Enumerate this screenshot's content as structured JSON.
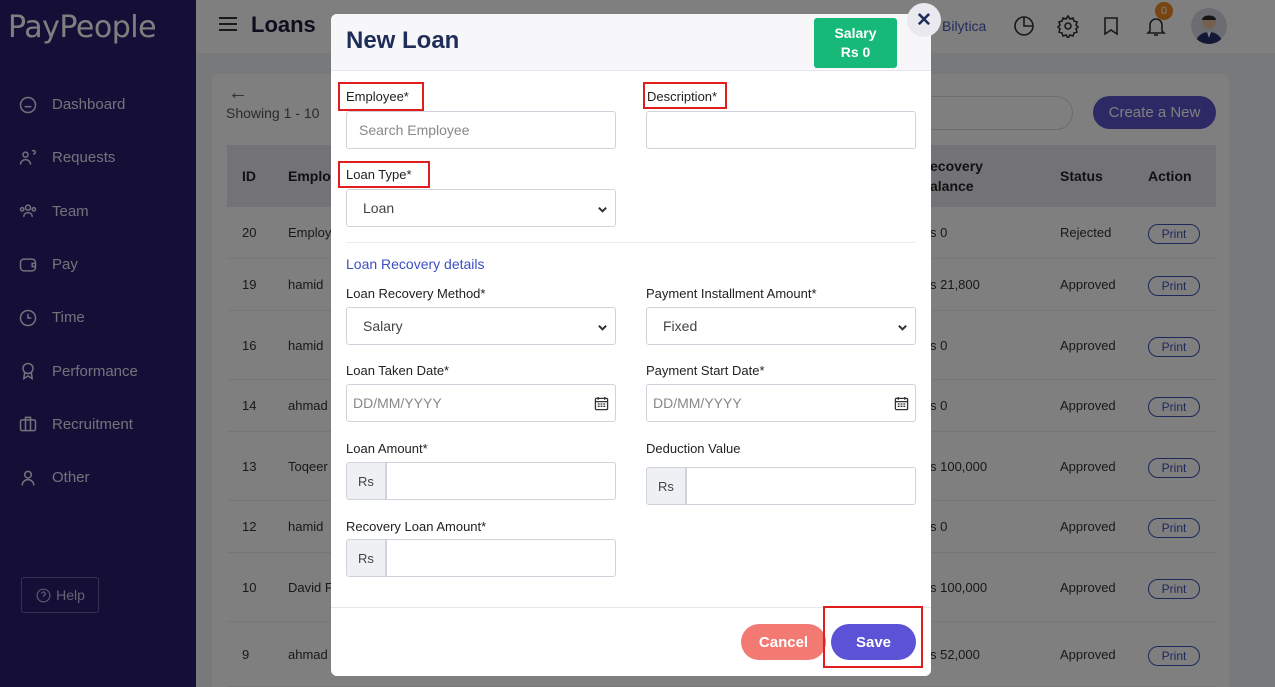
{
  "app": {
    "logo_text": "PayPe",
    "logo_text_end": "ple",
    "logo_o": "o"
  },
  "sidebar": {
    "items": [
      {
        "label": "Dashboard",
        "icon": "home-icon"
      },
      {
        "label": "Requests",
        "icon": "requests-icon"
      },
      {
        "label": "Team",
        "icon": "team-icon"
      },
      {
        "label": "Pay",
        "icon": "wallet-icon"
      },
      {
        "label": "Time",
        "icon": "clock-icon"
      },
      {
        "label": "Performance",
        "icon": "award-icon"
      },
      {
        "label": "Recruitment",
        "icon": "briefcase-icon"
      },
      {
        "label": "Other",
        "icon": "user-icon"
      }
    ],
    "help_label": "Help"
  },
  "header": {
    "title": "Loans",
    "company": "Bilytica",
    "notification_count": "0"
  },
  "list": {
    "back": "←",
    "showing": "Showing 1 - 10",
    "create_label": "Create a New",
    "columns": {
      "id": "ID",
      "employee": "Emplo",
      "recovery_line1": "ecovery",
      "recovery_line2": "alance",
      "status": "Status",
      "action": "Action"
    },
    "rows": [
      {
        "id": "20",
        "employee": "Employ",
        "balance": "s 0",
        "status": "Rejected",
        "action": "Print"
      },
      {
        "id": "19",
        "employee": "hamid",
        "balance": "s 21,800",
        "status": "Approved",
        "action": "Print"
      },
      {
        "id": "16",
        "employee": "hamid",
        "balance": "s 0",
        "status": "Approved",
        "action": "Print"
      },
      {
        "id": "14",
        "employee": "ahmad",
        "balance": "s 0",
        "status": "Approved",
        "action": "Print"
      },
      {
        "id": "13",
        "employee": "Toqeer",
        "balance": "s 100,000",
        "status": "Approved",
        "action": "Print"
      },
      {
        "id": "12",
        "employee": "hamid",
        "balance": "s 0",
        "status": "Approved",
        "action": "Print"
      },
      {
        "id": "10",
        "employee": "David F",
        "balance": "s 100,000",
        "status": "Approved",
        "action": "Print"
      },
      {
        "id": "9",
        "employee": "ahmad",
        "balance": "s 52,000",
        "status": "Approved",
        "action": "Print"
      }
    ]
  },
  "modal": {
    "title": "New Loan",
    "salary_label": "Salary",
    "salary_value": "Rs 0",
    "close": "✕",
    "employee_label": "Employee*",
    "employee_placeholder": "Search Employee",
    "description_label": "Description*",
    "loan_type_label": "Loan Type*",
    "loan_type_value": "Loan",
    "section_title": "Loan Recovery details",
    "recovery_method_label": "Loan Recovery Method*",
    "recovery_method_value": "Salary",
    "installment_label": "Payment Installment Amount*",
    "installment_value": "Fixed",
    "taken_date_label": "Loan Taken Date*",
    "taken_date_placeholder": "DD/MM/YYYY",
    "start_date_label": "Payment Start Date*",
    "start_date_placeholder": "DD/MM/YYYY",
    "loan_amount_label": "Loan Amount*",
    "deduction_label": "Deduction Value",
    "recovery_amount_label": "Recovery Loan Amount*",
    "currency": "Rs",
    "cancel_label": "Cancel",
    "save_label": "Save"
  },
  "colors": {
    "sidebar": "#2a1f6e",
    "accent": "#5b52d6",
    "salary": "#17b978",
    "cancel": "#f27a72",
    "highlight": "#e11d1d"
  }
}
